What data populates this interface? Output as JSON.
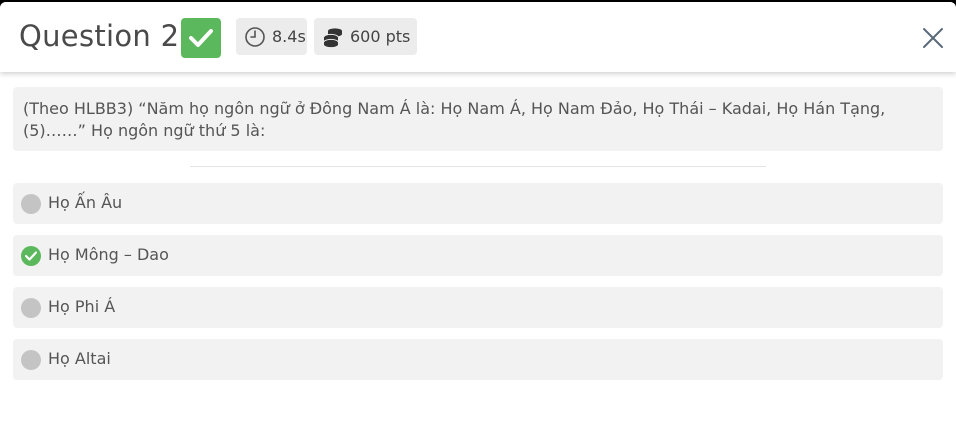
{
  "header": {
    "question_title": "Question 2",
    "time": "8.4s",
    "points": "600 pts",
    "status_icon": "check-icon",
    "time_icon": "clock-icon",
    "points_icon": "coins-icon",
    "close_icon": "close-icon"
  },
  "colors": {
    "correct": "#5cb85c",
    "unselected": "#c4c4c4",
    "option_bg": "#f2f2f2",
    "pill_bg": "#ececec"
  },
  "question": {
    "text": "(Theo HLBB3) “Năm họ ngôn ngữ ở Đông Nam Á là: Họ Nam Á, Họ Nam Đảo, Họ Thái – Kadai, Họ Hán Tạng, (5)……” Họ ngôn ngữ thứ 5 là:"
  },
  "options": [
    {
      "label": "Họ Ấn Âu",
      "correct": false
    },
    {
      "label": "Họ Mông – Dao",
      "correct": true
    },
    {
      "label": "Họ Phi Á",
      "correct": false
    },
    {
      "label": "Họ Altai",
      "correct": false
    }
  ]
}
